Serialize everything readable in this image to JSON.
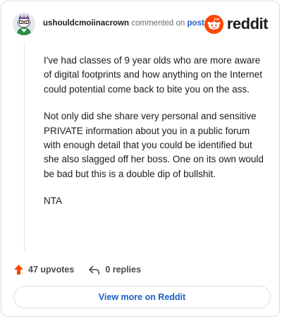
{
  "header": {
    "username": "ushouldcmoiinacrown",
    "commented_text": "commented on",
    "post_link": "post",
    "brand": "reddit"
  },
  "comment": {
    "paragraphs": [
      "I've had classes of 9 year olds who are more aware of digital footprints and how anything on the Internet could potential come back to bite you on the ass.",
      "Not only did she share very personal and sensitive PRIVATE information about you in a public forum with enough detail that you could be identified but she also slagged off her boss. One on its own would be bad but this is a double dip of bullshit.",
      "NTA"
    ]
  },
  "actions": {
    "upvotes": "47 upvotes",
    "replies": "0 replies"
  },
  "footer": {
    "view_more": "View more on Reddit"
  },
  "colors": {
    "upvote": "#ff4500",
    "link": "#1a5ec7",
    "brand": "#ff4500"
  },
  "icons": {
    "avatar": "snoo-avatar",
    "brand": "reddit-snoo-icon",
    "upvote": "upvote-arrow-icon",
    "reply": "reply-arrow-icon"
  }
}
